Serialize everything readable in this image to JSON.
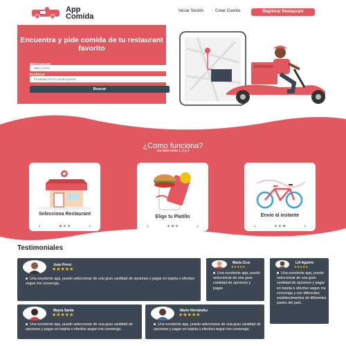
{
  "header": {
    "logo_line1": "App",
    "logo_line2": "Comida",
    "nav_login": "Iniciar Sesión",
    "nav_sep": "·",
    "nav_create": "Crear Cuenta",
    "register_button": "Registrar Restaurant"
  },
  "hero": {
    "title": "Encuentra y pide comida de tu restaurant favorito",
    "restaurant_label": "RESTAURANT",
    "restaurant_placeholder": "Mars d'orzo",
    "dish_label": "PLATILLO",
    "dish_placeholder": "Ensalada Pizza Hamburguesa",
    "search_button": "Buscar"
  },
  "how": {
    "title": "¿Como funciona?",
    "subtitle": "tan fácil como 1, 2 y 3",
    "steps": [
      {
        "title": "Selecciona Restaurant"
      },
      {
        "title": "Elige tu Platillo"
      },
      {
        "title": "Envio al instante"
      }
    ],
    "prev": "‹",
    "next": "›"
  },
  "testimonials": {
    "heading": "Testimoniales",
    "stars": "★★★★★",
    "items": [
      {
        "name": "Juan Perez",
        "text": "Una excelente app, puedo seleccionar de una gran cantidad de opciones y pagar en tarjeta o efectivo segun me convenga."
      },
      {
        "name": "Maria Cruz",
        "text": "Una excelente app, puedo seleccionar de una gran cantidad de opciones y pagar."
      },
      {
        "name": "Lili Aguirre",
        "text": "Una excelente app, puedo seleccionar de una gran cantidad de opciones y pagar en tarjeta o efectivo segun me convenga y con diferentes establecimientos de diferentes partes del país."
      },
      {
        "name": "Mayra Santa",
        "text": "Una excelente app, puedo seleccionar de una gran cantidad de opciones y pagar en tarjeta o efectivo segun me convenga."
      },
      {
        "name": "Mario Hernández",
        "text": "Una excelente app, puedo seleccionar de una gran cantidad de opciones y pagar en tarjeta o efectivo segun me convenga."
      }
    ]
  },
  "colors": {
    "accent": "#e3575f",
    "dark": "#3d4753",
    "star": "#f5c518"
  }
}
